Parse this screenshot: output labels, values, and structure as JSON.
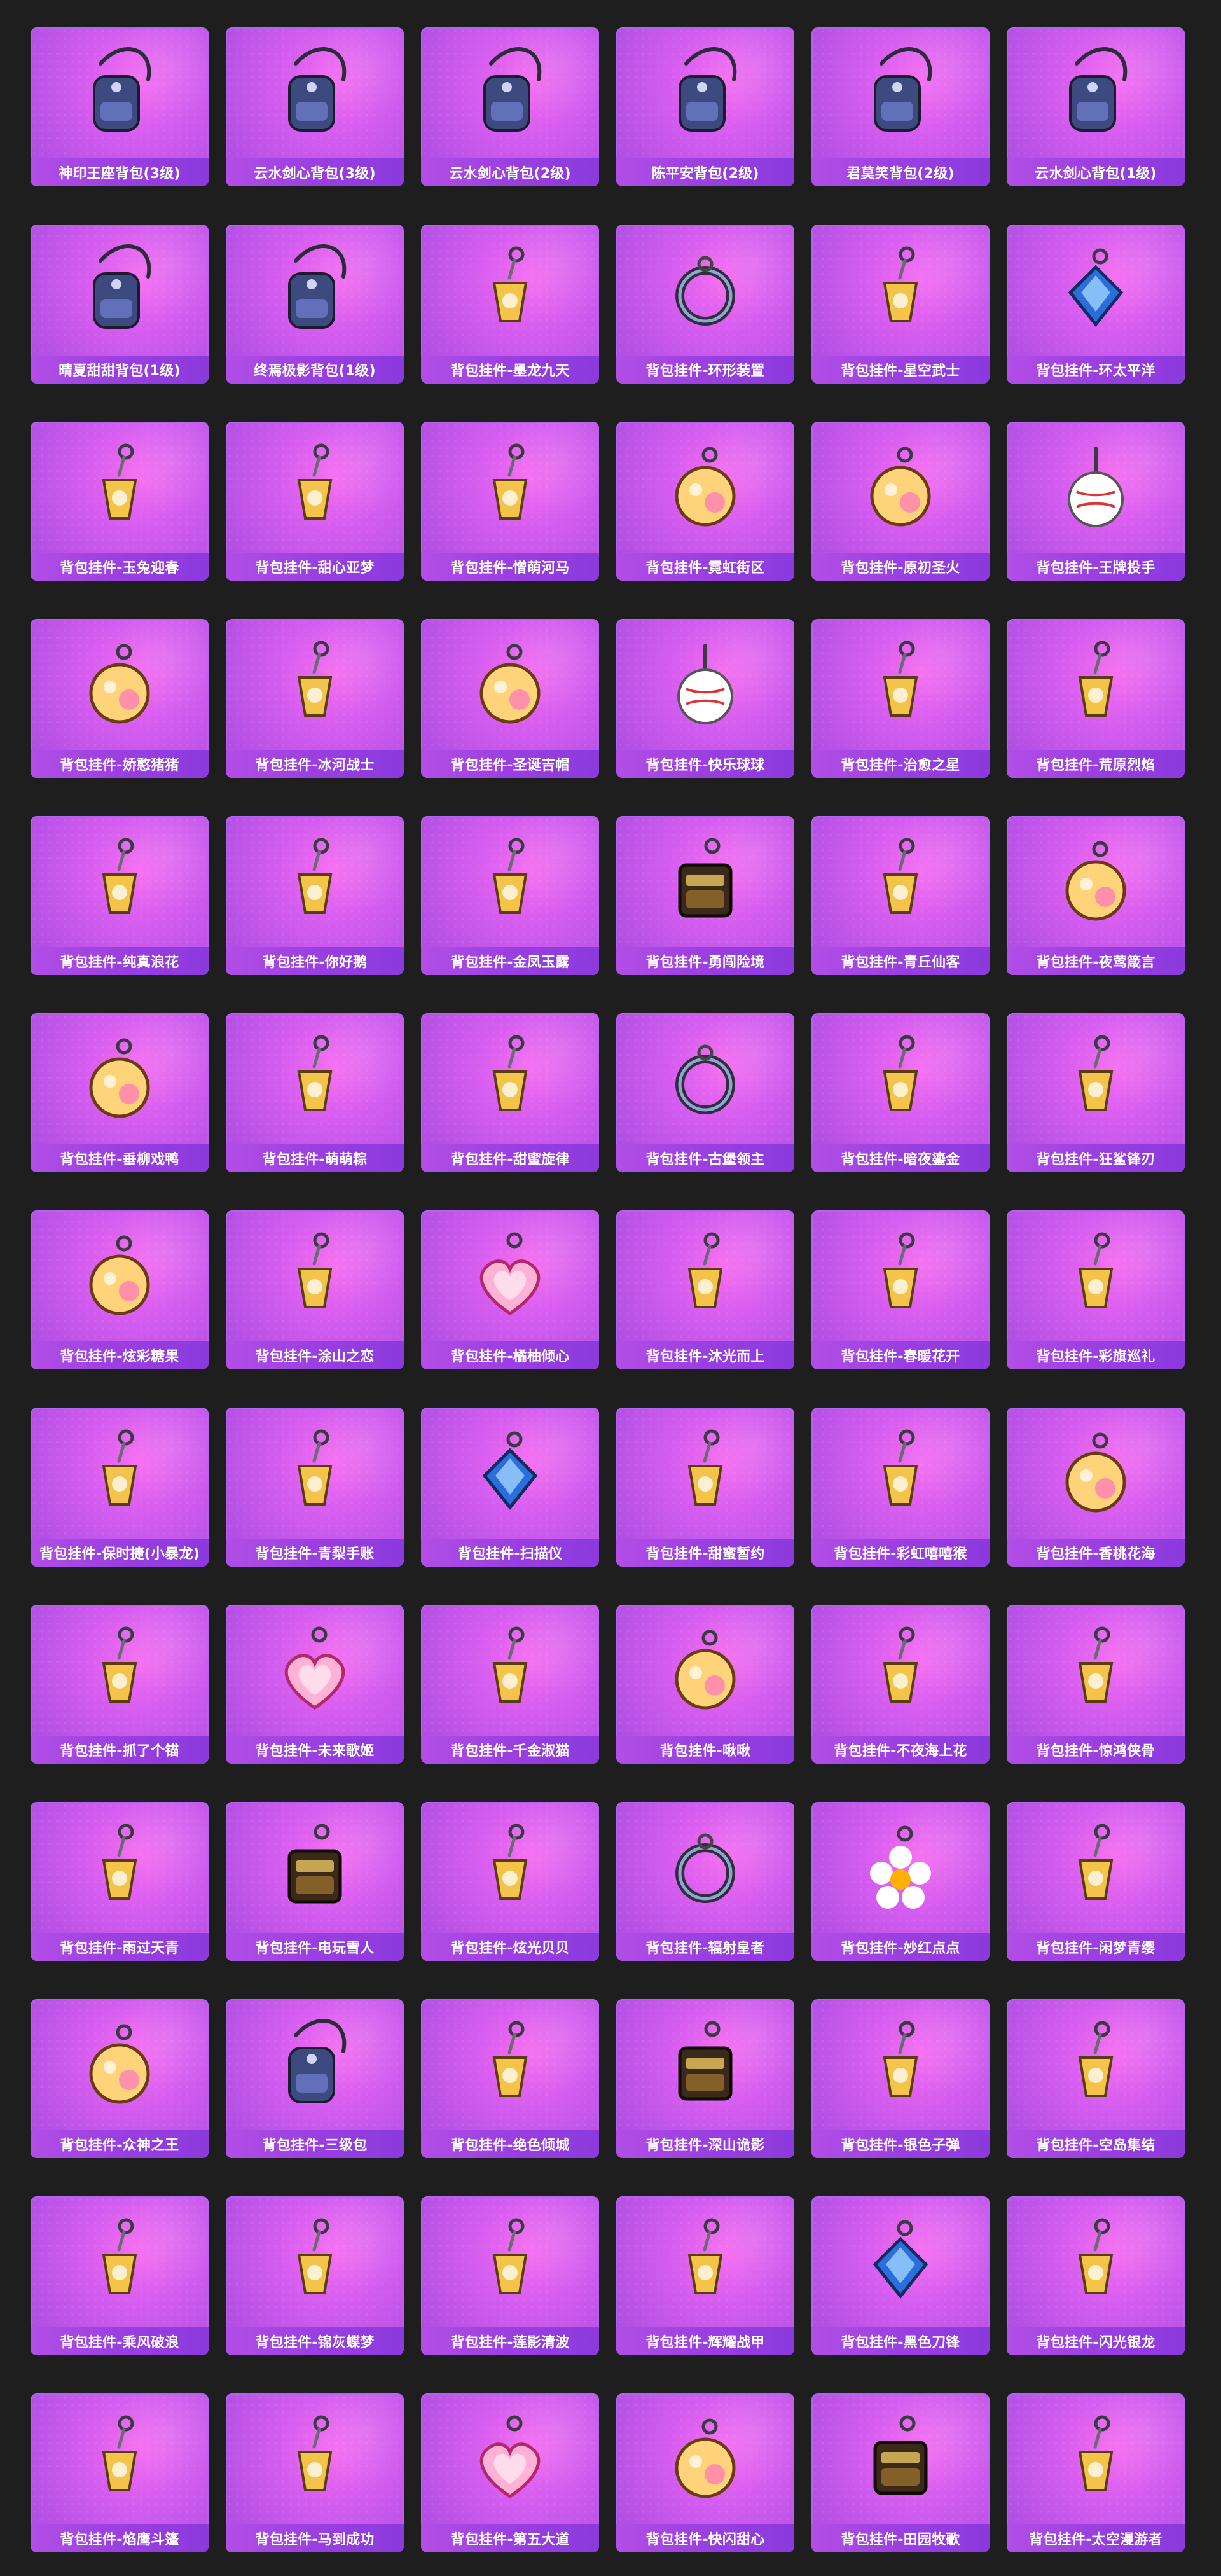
{
  "items": [
    {
      "name": "神印王座背包(3级)",
      "icon": "backpack-icon",
      "kind": "backpack"
    },
    {
      "name": "云水剑心背包(3级)",
      "icon": "backpack-icon",
      "kind": "backpack"
    },
    {
      "name": "云水剑心背包(2级)",
      "icon": "backpack-icon",
      "kind": "backpack"
    },
    {
      "name": "陈平安背包(2级)",
      "icon": "backpack-icon",
      "kind": "backpack"
    },
    {
      "name": "君莫笑背包(2级)",
      "icon": "backpack-icon",
      "kind": "backpack"
    },
    {
      "name": "云水剑心背包(1级)",
      "icon": "backpack-icon",
      "kind": "backpack"
    },
    {
      "name": "晴夏甜甜背包(1级)",
      "icon": "backpack-icon",
      "kind": "backpack"
    },
    {
      "name": "终焉极影背包(1级)",
      "icon": "backpack-icon",
      "kind": "backpack"
    },
    {
      "name": "背包挂件-墨龙九天",
      "icon": "charm-icon",
      "kind": "charm"
    },
    {
      "name": "背包挂件-环形装置",
      "icon": "charm-icon",
      "kind": "ring"
    },
    {
      "name": "背包挂件-星空武士",
      "icon": "charm-icon",
      "kind": "charm"
    },
    {
      "name": "背包挂件-环太平洋",
      "icon": "charm-icon",
      "kind": "gem"
    },
    {
      "name": "背包挂件-玉兔迎春",
      "icon": "charm-icon",
      "kind": "charm"
    },
    {
      "name": "背包挂件-甜心亚梦",
      "icon": "charm-icon",
      "kind": "charm"
    },
    {
      "name": "背包挂件-憎萌河马",
      "icon": "charm-icon",
      "kind": "charm"
    },
    {
      "name": "背包挂件-霓虹街区",
      "icon": "charm-icon",
      "kind": "round"
    },
    {
      "name": "背包挂件-原初圣火",
      "icon": "charm-icon",
      "kind": "round"
    },
    {
      "name": "背包挂件-王牌投手",
      "icon": "charm-icon",
      "kind": "ball"
    },
    {
      "name": "背包挂件-娇憨猪猪",
      "icon": "charm-icon",
      "kind": "round"
    },
    {
      "name": "背包挂件-冰河战士",
      "icon": "charm-icon",
      "kind": "charm"
    },
    {
      "name": "背包挂件-圣诞吉帽",
      "icon": "charm-icon",
      "kind": "round"
    },
    {
      "name": "背包挂件-快乐球球",
      "icon": "charm-icon",
      "kind": "ball"
    },
    {
      "name": "背包挂件-治愈之星",
      "icon": "charm-icon",
      "kind": "charm"
    },
    {
      "name": "背包挂件-荒原烈焰",
      "icon": "charm-icon",
      "kind": "charm"
    },
    {
      "name": "背包挂件-纯真浪花",
      "icon": "charm-icon",
      "kind": "charm"
    },
    {
      "name": "背包挂件-你好鹅",
      "icon": "charm-icon",
      "kind": "charm"
    },
    {
      "name": "背包挂件-金凤玉露",
      "icon": "charm-icon",
      "kind": "charm"
    },
    {
      "name": "背包挂件-勇闯险境",
      "icon": "charm-icon",
      "kind": "box"
    },
    {
      "name": "背包挂件-青丘仙客",
      "icon": "charm-icon",
      "kind": "charm"
    },
    {
      "name": "背包挂件-夜莺箴言",
      "icon": "charm-icon",
      "kind": "round"
    },
    {
      "name": "背包挂件-垂柳戏鸭",
      "icon": "charm-icon",
      "kind": "round"
    },
    {
      "name": "背包挂件-萌萌粽",
      "icon": "charm-icon",
      "kind": "charm"
    },
    {
      "name": "背包挂件-甜蜜旋律",
      "icon": "charm-icon",
      "kind": "charm"
    },
    {
      "name": "背包挂件-古堡领主",
      "icon": "charm-icon",
      "kind": "ring"
    },
    {
      "name": "背包挂件-暗夜鎏金",
      "icon": "charm-icon",
      "kind": "charm"
    },
    {
      "name": "背包挂件-狂鲨锋刃",
      "icon": "charm-icon",
      "kind": "charm"
    },
    {
      "name": "背包挂件-炫彩糖果",
      "icon": "charm-icon",
      "kind": "round"
    },
    {
      "name": "背包挂件-涂山之恋",
      "icon": "charm-icon",
      "kind": "charm"
    },
    {
      "name": "背包挂件-橘柚倾心",
      "icon": "charm-icon",
      "kind": "heart"
    },
    {
      "name": "背包挂件-沐光而上",
      "icon": "charm-icon",
      "kind": "charm"
    },
    {
      "name": "背包挂件-春暖花开",
      "icon": "charm-icon",
      "kind": "charm"
    },
    {
      "name": "背包挂件-彩旗巡礼",
      "icon": "charm-icon",
      "kind": "charm"
    },
    {
      "name": "背包挂件-保时捷(小暴龙)",
      "icon": "charm-icon",
      "kind": "charm"
    },
    {
      "name": "背包挂件-青梨手账",
      "icon": "charm-icon",
      "kind": "charm"
    },
    {
      "name": "背包挂件-扫描仪",
      "icon": "charm-icon",
      "kind": "gem"
    },
    {
      "name": "背包挂件-甜蜜暂约",
      "icon": "charm-icon",
      "kind": "charm"
    },
    {
      "name": "背包挂件-彩虹嘻嘻猴",
      "icon": "charm-icon",
      "kind": "charm"
    },
    {
      "name": "背包挂件-香桃花海",
      "icon": "charm-icon",
      "kind": "round"
    },
    {
      "name": "背包挂件-抓了个锚",
      "icon": "charm-icon",
      "kind": "charm"
    },
    {
      "name": "背包挂件-未来歌姬",
      "icon": "charm-icon",
      "kind": "heart"
    },
    {
      "name": "背包挂件-千金淑猫",
      "icon": "charm-icon",
      "kind": "charm"
    },
    {
      "name": "背包挂件-啾啾",
      "icon": "charm-icon",
      "kind": "round"
    },
    {
      "name": "背包挂件-不夜海上花",
      "icon": "charm-icon",
      "kind": "charm"
    },
    {
      "name": "背包挂件-惊鸿侠骨",
      "icon": "charm-icon",
      "kind": "charm"
    },
    {
      "name": "背包挂件-雨过天青",
      "icon": "charm-icon",
      "kind": "charm"
    },
    {
      "name": "背包挂件-电玩雪人",
      "icon": "charm-icon",
      "kind": "box"
    },
    {
      "name": "背包挂件-炫光贝贝",
      "icon": "charm-icon",
      "kind": "charm"
    },
    {
      "name": "背包挂件-辐射皇者",
      "icon": "charm-icon",
      "kind": "ring"
    },
    {
      "name": "背包挂件-妙红点点",
      "icon": "charm-icon",
      "kind": "flower"
    },
    {
      "name": "背包挂件-闲梦青缨",
      "icon": "charm-icon",
      "kind": "charm"
    },
    {
      "name": "背包挂件-众神之王",
      "icon": "charm-icon",
      "kind": "round"
    },
    {
      "name": "背包挂件-三级包",
      "icon": "backpack-icon",
      "kind": "backpack"
    },
    {
      "name": "背包挂件-绝色倾城",
      "icon": "charm-icon",
      "kind": "charm"
    },
    {
      "name": "背包挂件-深山诡影",
      "icon": "charm-icon",
      "kind": "box"
    },
    {
      "name": "背包挂件-银色子弹",
      "icon": "charm-icon",
      "kind": "charm"
    },
    {
      "name": "背包挂件-空岛集结",
      "icon": "charm-icon",
      "kind": "charm"
    },
    {
      "name": "背包挂件-乘风破浪",
      "icon": "charm-icon",
      "kind": "charm"
    },
    {
      "name": "背包挂件-锦灰蝶梦",
      "icon": "charm-icon",
      "kind": "charm"
    },
    {
      "name": "背包挂件-莲影清波",
      "icon": "charm-icon",
      "kind": "charm"
    },
    {
      "name": "背包挂件-辉耀战甲",
      "icon": "charm-icon",
      "kind": "charm"
    },
    {
      "name": "背包挂件-黑色刀锋",
      "icon": "charm-icon",
      "kind": "gem"
    },
    {
      "name": "背包挂件-闪光银龙",
      "icon": "charm-icon",
      "kind": "charm"
    },
    {
      "name": "背包挂件-焰鹰斗篷",
      "icon": "charm-icon",
      "kind": "charm"
    },
    {
      "name": "背包挂件-马到成功",
      "icon": "charm-icon",
      "kind": "charm"
    },
    {
      "name": "背包挂件-第五大道",
      "icon": "charm-icon",
      "kind": "heart"
    },
    {
      "name": "背包挂件-快闪甜心",
      "icon": "charm-icon",
      "kind": "round"
    },
    {
      "name": "背包挂件-田园牧歌",
      "icon": "charm-icon",
      "kind": "box"
    },
    {
      "name": "背包挂件-太空漫游者",
      "icon": "charm-icon",
      "kind": "charm"
    }
  ]
}
